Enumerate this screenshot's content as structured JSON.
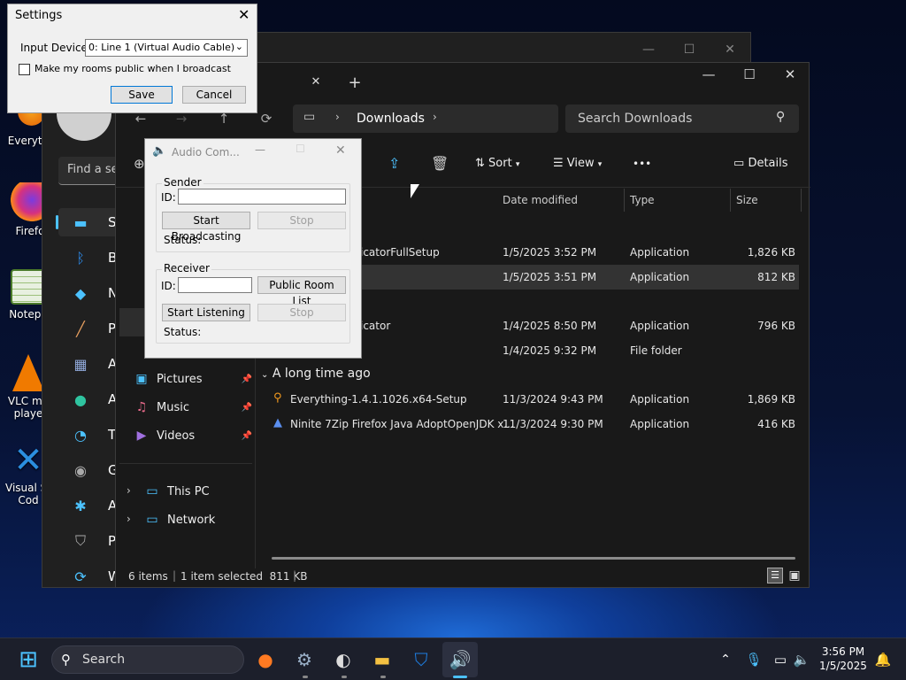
{
  "desktop": {
    "icons": [
      {
        "label": "Everyth",
        "icon": "everything-icon"
      },
      {
        "label": "Firefo",
        "icon": "firefox-icon"
      },
      {
        "label": "Notepa",
        "icon": "notepad-icon"
      },
      {
        "label": "VLC me\nplaye",
        "icon": "vlc-icon"
      },
      {
        "label": "Visual St\nCod",
        "icon": "vscode-icon"
      }
    ]
  },
  "settings_app": {
    "search_placeholder": "Find a se",
    "items": [
      {
        "label": "Syst",
        "icon": "system-icon"
      },
      {
        "label": "Blue",
        "icon": "bluetooth-icon"
      },
      {
        "label": "Net",
        "icon": "network-icon"
      },
      {
        "label": "Pers",
        "icon": "brush-icon"
      },
      {
        "label": "App",
        "icon": "apps-icon"
      },
      {
        "label": "Acc",
        "icon": "accounts-icon"
      },
      {
        "label": "Tim",
        "icon": "time-icon"
      },
      {
        "label": "Gar",
        "icon": "gaming-icon"
      },
      {
        "label": "Acc",
        "icon": "accessibility-icon"
      },
      {
        "label": "Priv",
        "icon": "privacy-icon"
      },
      {
        "label": "Win",
        "icon": "update-icon"
      }
    ]
  },
  "explorer": {
    "tab_close": "✕",
    "tab_add": "+",
    "breadcrumb": "Downloads",
    "search_placeholder": "Search Downloads",
    "toolbar": {
      "sort": "Sort",
      "view": "View",
      "more": "•••",
      "details": "Details"
    },
    "columns": {
      "date": "Date modified",
      "type": "Type",
      "size": "Size"
    },
    "group_older": "A long time ago",
    "files": [
      {
        "name": "icatorFullSetup",
        "date": "1/5/2025 3:52 PM",
        "type": "Application",
        "size": "1,826 KB",
        "selected": false
      },
      {
        "name": "",
        "date": "1/5/2025 3:51 PM",
        "type": "Application",
        "size": "812 KB",
        "selected": true
      },
      {
        "name": "icator",
        "date": "1/4/2025 8:50 PM",
        "type": "Application",
        "size": "796 KB",
        "selected": false
      },
      {
        "name": "",
        "date": "1/4/2025 9:32 PM",
        "type": "File folder",
        "size": "",
        "selected": false
      },
      {
        "name": "Everything-1.4.1.1026.x64-Setup",
        "date": "11/3/2024 9:43 PM",
        "type": "Application",
        "size": "1,869 KB",
        "selected": false
      },
      {
        "name": "Ninite 7Zip Firefox Java AdoptOpenJDK x...",
        "date": "11/3/2024 9:30 PM",
        "type": "Application",
        "size": "416 KB",
        "selected": false
      }
    ],
    "nav": [
      {
        "label": "Pictures",
        "icon": "pictures-icon",
        "pinned": true
      },
      {
        "label": "Music",
        "icon": "music-icon",
        "pinned": true
      },
      {
        "label": "Videos",
        "icon": "videos-icon",
        "pinned": true
      },
      {
        "label": "This PC",
        "icon": "this-pc-icon",
        "pinned": false
      },
      {
        "label": "Network",
        "icon": "network-icon",
        "pinned": false
      }
    ],
    "status": {
      "items": "6 items",
      "selected": "1 item selected  811 KB"
    }
  },
  "dialog": {
    "title": "Settings",
    "input_device_label": "Input Device:",
    "input_device_value": "0: Line 1 (Virtual Audio Cable)",
    "public_rooms_label": "Make my rooms public when I broadcast",
    "save": "Save",
    "cancel": "Cancel"
  },
  "audio_app": {
    "title": "Audio Com...",
    "sender": {
      "legend": "Sender",
      "id_label": "ID:",
      "start": "Start Broadcasting",
      "stop": "Stop",
      "status_label": "Status:"
    },
    "receiver": {
      "legend": "Receiver",
      "id_label": "ID:",
      "public_list": "Public Room List",
      "start": "Start Listening",
      "stop": "Stop",
      "status_label": "Status:"
    }
  },
  "taskbar": {
    "search": "Search",
    "time": "3:56 PM",
    "date": "1/5/2025"
  },
  "colors": {
    "accent": "#0078d7",
    "selection": "#333333",
    "taskbar": "#1c1f2b"
  }
}
